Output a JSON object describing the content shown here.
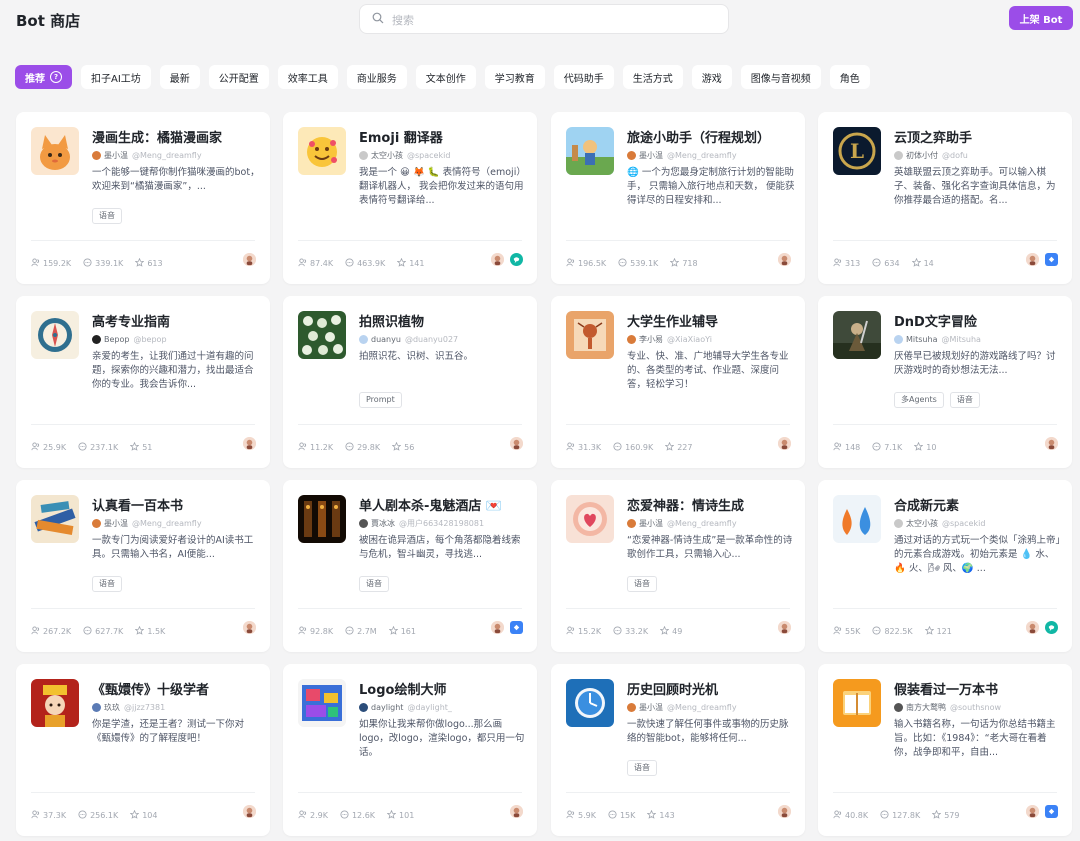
{
  "header": {
    "title": "Bot 商店",
    "search_placeholder": "搜索",
    "publish_label": "上架 Bot"
  },
  "tabs": [
    {
      "label": "推荐",
      "active": true
    },
    {
      "label": "扣子AI工坊"
    },
    {
      "label": "最新"
    },
    {
      "label": "公开配置"
    },
    {
      "label": "效率工具"
    },
    {
      "label": "商业服务"
    },
    {
      "label": "文本创作"
    },
    {
      "label": "学习教育"
    },
    {
      "label": "代码助手"
    },
    {
      "label": "生活方式"
    },
    {
      "label": "游戏"
    },
    {
      "label": "图像与音视频"
    },
    {
      "label": "角色"
    }
  ],
  "cards": [
    {
      "name": "漫画生成：橘猫漫画家",
      "author": "墨小温",
      "handle": "@Meng_dreamfly",
      "description": "一个能够一键帮你制作猫咪漫画的bot， 欢迎来到“橘猫漫画家”，...",
      "tags": [
        "语音"
      ],
      "users": "159.2K",
      "chats": "339.1K",
      "stars": "613",
      "models": [
        "face"
      ],
      "avatar": "cat",
      "author_color": "#d97b3a"
    },
    {
      "name": "Emoji 翻译器",
      "author": "太空小孩",
      "handle": "@spacekid",
      "description": "我是一个 😀 🦊 🐛 表情符号（emoji） 翻译机器人， 我会把你发过来的语句用表情符号翻译给...",
      "tags": [],
      "users": "87.4K",
      "chats": "463.9K",
      "stars": "141",
      "models": [
        "face",
        "teal"
      ],
      "avatar": "emoji",
      "author_color": "#c9c9c9",
      "desc3": true
    },
    {
      "name": "旅途小助手（行程规划）",
      "author": "墨小温",
      "handle": "@Meng_dreamfly",
      "description": "🌐 一个为您最身定制旅行计划的智能助手， 只需输入旅行地点和天数， 便能获得详尽的日程安排和...",
      "tags": [],
      "users": "196.5K",
      "chats": "539.1K",
      "stars": "718",
      "models": [
        "face"
      ],
      "avatar": "travel",
      "author_color": "#d97b3a",
      "desc3": true
    },
    {
      "name": "云顶之弈助手",
      "author": "初体小付",
      "handle": "@dofu",
      "description": "英雄联盟云顶之弈助手。可以输入棋子、装备、强化名字查询具体信息，为你推荐最合适的搭配。名...",
      "tags": [],
      "users": "313",
      "chats": "634",
      "stars": "14",
      "models": [
        "face",
        "blue"
      ],
      "avatar": "lol",
      "author_color": "#c9c9c9",
      "desc3": true
    },
    {
      "name": "高考专业指南",
      "author": "Bepop",
      "handle": "@bepop",
      "description": "亲爱的考生，让我们通过十道有趣的问题，探索你的兴趣和潜力，找出最适合你的专业。我会告诉你...",
      "tags": [],
      "users": "25.9K",
      "chats": "237.1K",
      "stars": "51",
      "models": [
        "face"
      ],
      "avatar": "compass",
      "author_color": "#222222",
      "desc3": true
    },
    {
      "name": "拍照识植物",
      "author": "duanyu",
      "handle": "@duanyu027",
      "description": "拍照识花、识树、识五谷。",
      "tags": [
        "Prompt"
      ],
      "users": "11.2K",
      "chats": "29.8K",
      "stars": "56",
      "models": [
        "face"
      ],
      "avatar": "plant",
      "author_color": "#b9d3f0"
    },
    {
      "name": "大学生作业辅导",
      "author": "李小易",
      "handle": "@XiaXiaoYi",
      "description": "专业、快、准、广地辅导大学生各专业的、各类型的考试、作业题、深度问答，轻松学习！",
      "tags": [],
      "users": "31.3K",
      "chats": "160.9K",
      "stars": "227",
      "models": [
        "face"
      ],
      "avatar": "student",
      "author_color": "#d97b3a",
      "desc3": true
    },
    {
      "name": "DnD文字冒险",
      "author": "Mitsuha",
      "handle": "@Mitsuha",
      "description": "厌倦早已被规划好的游戏路线了吗？讨厌游戏时的奇妙想法无法...",
      "tags": [
        "多Agents",
        "语音"
      ],
      "users": "148",
      "chats": "7.1K",
      "stars": "10",
      "models": [
        "face"
      ],
      "avatar": "dnd",
      "author_color": "#b9d3f0"
    },
    {
      "name": "认真看一百本书",
      "author": "墨小温",
      "handle": "@Meng_dreamfly",
      "description": "一款专门为阅读爱好者设计的AI读书工具。只需输入书名，AI便能...",
      "tags": [
        "语音"
      ],
      "users": "267.2K",
      "chats": "627.7K",
      "stars": "1.5K",
      "models": [
        "face"
      ],
      "avatar": "books",
      "author_color": "#d97b3a"
    },
    {
      "name": "单人剧本杀-鬼魅酒店 💌",
      "author": "賈冰冰",
      "handle": "@用户6634281980​81",
      "description": "被困在诡异酒店，每个角落都隐着线索与危机，智斗幽灵，寻找逃...",
      "tags": [
        "语音"
      ],
      "users": "92.8K",
      "chats": "2.7M",
      "stars": "161",
      "models": [
        "face",
        "blue"
      ],
      "avatar": "hotel",
      "author_color": "#555555"
    },
    {
      "name": "恋爱神器：情诗生成",
      "author": "墨小温",
      "handle": "@Meng_dreamfly",
      "description": "“恋爱神器-情诗生成”是一款革命性的诗歌创作工具，只需输入心...",
      "tags": [
        "语音"
      ],
      "users": "15.2K",
      "chats": "33.2K",
      "stars": "49",
      "models": [
        "face"
      ],
      "avatar": "love",
      "author_color": "#d97b3a"
    },
    {
      "name": "合成新元素",
      "author": "太空小孩",
      "handle": "@spacekid",
      "description": "通过对话的方式玩一个类似「涂鸦上帝」的元素合成游戏。初始元素是 💧 水、🔥 火、🌬 风、🌍 ...",
      "tags": [],
      "users": "55K",
      "chats": "822.5K",
      "stars": "121",
      "models": [
        "face",
        "teal"
      ],
      "avatar": "elements",
      "author_color": "#c9c9c9",
      "desc3": true
    },
    {
      "name": "《甄嬛传》十级学者",
      "author": "玖玖",
      "handle": "@jjzz7381",
      "description": "你是学渣，还是王者？测试一下你对《甄嬛传》的了解程度吧！",
      "tags": [],
      "users": "37.3K",
      "chats": "256.1K",
      "stars": "104",
      "models": [
        "face"
      ],
      "avatar": "zhenhuan",
      "author_color": "#5b7bb5"
    },
    {
      "name": "Logo绘制大师",
      "author": "daylight",
      "handle": "@daylight_",
      "description": "如果你让我来帮你做logo...那么画logo，改logo，渲染logo，都只用一句话。",
      "tags": [],
      "users": "2.9K",
      "chats": "12.6K",
      "stars": "101",
      "models": [
        "face"
      ],
      "avatar": "logo",
      "author_color": "#2b4d7a",
      "desc3": true
    },
    {
      "name": "历史回顾时光机",
      "author": "墨小温",
      "handle": "@Meng_dreamfly",
      "description": "一款快速了解任何事件或事物的历史脉络的智能bot，能够将任何...",
      "tags": [
        "语音"
      ],
      "users": "5.9K",
      "chats": "15K",
      "stars": "143",
      "models": [
        "face"
      ],
      "avatar": "history",
      "author_color": "#d97b3a"
    },
    {
      "name": "假装看过一万本书",
      "author": "南方大鹜鸭",
      "handle": "@southsnow",
      "description": "输入书籍名称，一句话为你总结书籍主旨。比如：《1984》：“老大哥在看着你，战争即和平，自由...",
      "tags": [],
      "users": "40.8K",
      "chats": "127.8K",
      "stars": "579",
      "models": [
        "face",
        "blue"
      ],
      "avatar": "readbook",
      "author_color": "#555555",
      "desc3": true
    }
  ]
}
